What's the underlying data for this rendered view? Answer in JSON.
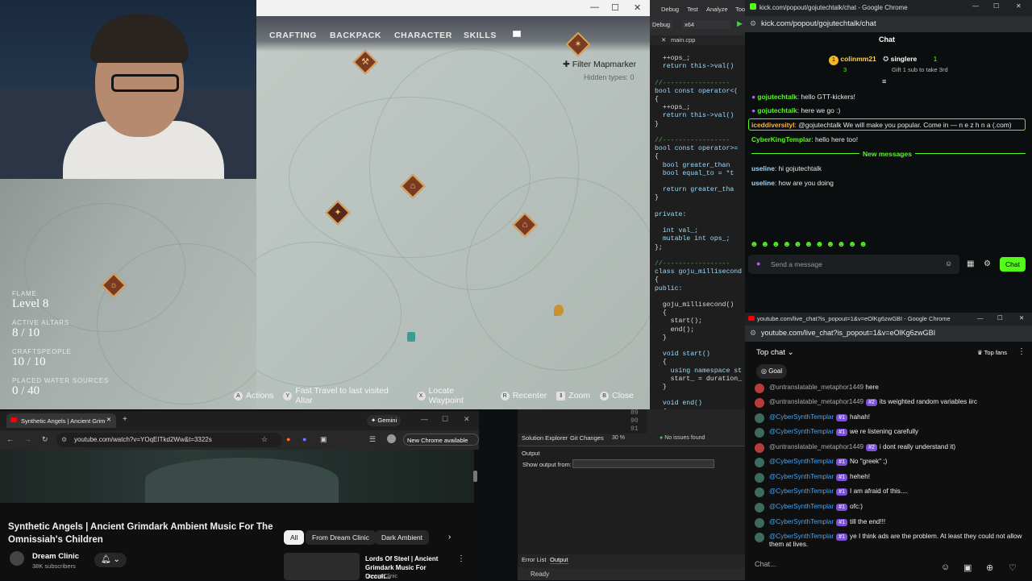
{
  "webcam": {
    "label": "webcam"
  },
  "game": {
    "window_buttons": [
      "—",
      "☐",
      "✕"
    ],
    "menu": [
      "CRAFTING",
      "BACKPACK",
      "CHARACTER",
      "SKILLS"
    ],
    "filter": {
      "label": "Filter Mapmarker",
      "hidden": "Hidden types: 0"
    },
    "stats": [
      {
        "key": "FLAME",
        "value": "Level 8"
      },
      {
        "key": "ACTIVE ALTARS",
        "value": "8 / 10"
      },
      {
        "key": "CRAFTSPEOPLE",
        "value": "10 / 10"
      },
      {
        "key": "PLACED WATER SOURCES",
        "value": "0 / 40"
      }
    ],
    "prompts": [
      "Actions",
      "Fast Travel to last visited Altar",
      "Locate Waypoint",
      "Recenter",
      "Zoom",
      "Close"
    ],
    "marker_icons": [
      "⚒",
      "⌂",
      "✦",
      "⌂",
      "☼",
      "✶",
      "⛁"
    ]
  },
  "vs": {
    "menu": [
      "Debug",
      "Test",
      "Analyze",
      "Too"
    ],
    "config": "Debug",
    "platform": "x64",
    "file_tab": "main.cpp",
    "code_lines": [
      "  ++ops_;",
      "  return this->val()",
      "",
      "//-----------------",
      "bool const operator<(",
      "{",
      "  ++ops_;",
      "  return this->val()",
      "}",
      "",
      "//-----------------",
      "bool const operator>=",
      "{",
      "  bool greater_than",
      "  bool equal_to = *t",
      "",
      "  return greater_tha",
      "}",
      "",
      "private:",
      "",
      "  int val_;",
      "  mutable int ops_;",
      "};",
      "",
      "//-----------------",
      "class goju_millisecond",
      "{",
      "public:",
      "",
      "  goju_millisecond()",
      "  {",
      "    start();",
      "    end();",
      "  }",
      "",
      "  void start()",
      "  {",
      "    using namespace st",
      "    start_ = duration_",
      "  }",
      "",
      "  void end()",
      "  {",
      "    using namespace st"
    ],
    "line_numbers": [
      "89",
      "90",
      "91"
    ],
    "zoom": "30 %",
    "issues": "No issues found",
    "panel_tabs": [
      "Solution Explorer",
      "Git Changes"
    ],
    "output_label": "Output",
    "show_output_from": "Show output from:",
    "bottom_tabs": [
      "Error List",
      "Output"
    ],
    "status": "Ready"
  },
  "kick": {
    "window_title": "kick.com/popout/gojutechtalk/chat - Google Chrome",
    "url": "kick.com/popout/gojutechtalk/chat",
    "header": "Chat",
    "pinned": {
      "user1": "colinmm21",
      "count1": "3",
      "user2": "singlere",
      "count2": "1",
      "gift": "Gift 1 sub to take 3rd"
    },
    "messages": [
      {
        "user": "gojutechtalk",
        "text": "hello GTT-kickers!",
        "color": "#53fc18"
      },
      {
        "user": "gojutechtalk",
        "text": "here we go :)",
        "color": "#53fc18"
      },
      {
        "user": "iceddiversityl",
        "text": "@gojutechtalk We will make you popular. Come in — n e z h n a (.com)",
        "color": "#ffb347"
      },
      {
        "user": "CyberKingTemplar",
        "text": "hello here too!",
        "color": "#53fc18"
      }
    ],
    "new_messages": "New messages",
    "messages2": [
      {
        "user": "useline",
        "text": "hi gojutechtalk",
        "color": "#9ad9ff"
      },
      {
        "user": "useline",
        "text": "how are you doing",
        "color": "#9ad9ff"
      }
    ],
    "input_placeholder": "Send a message",
    "chat_button": "Chat"
  },
  "ytchat": {
    "window_title": "youtube.com/live_chat?is_popout=1&v=eOlKg6zwGBI - Google Chrome",
    "url": "youtube.com/live_chat?is_popout=1&v=eOlKg6zwGBI",
    "top_chat": "Top chat",
    "top_fans": "Top fans",
    "goal": "Goal",
    "messages": [
      {
        "user": "@untranslatable_metaphor1449",
        "badge": "",
        "text": "here",
        "muted": true
      },
      {
        "user": "@untranslatable_metaphor1449",
        "badge": "#2",
        "text": "its weighted random variables iirc",
        "muted": true
      },
      {
        "user": "@CyberSynthTemplar",
        "badge": "#1",
        "text": "hahah!",
        "muted": false
      },
      {
        "user": "@CyberSynthTemplar",
        "badge": "#1",
        "text": "we re listening carefully",
        "muted": false
      },
      {
        "user": "@untranslatable_metaphor1449",
        "badge": "#2",
        "text": "i dont really understand it)",
        "muted": true
      },
      {
        "user": "@CyberSynthTemplar",
        "badge": "#1",
        "text": "No \"greek\" ;)",
        "muted": false
      },
      {
        "user": "@CyberSynthTemplar",
        "badge": "#1",
        "text": "heheh!",
        "muted": false
      },
      {
        "user": "@CyberSynthTemplar",
        "badge": "#1",
        "text": "I am afraid of this....",
        "muted": false
      },
      {
        "user": "@CyberSynthTemplar",
        "badge": "#1",
        "text": "ofc:)",
        "muted": false
      },
      {
        "user": "@CyberSynthTemplar",
        "badge": "#1",
        "text": "till the end!!!",
        "muted": false
      },
      {
        "user": "@CyberSynthTemplar",
        "badge": "#1",
        "text": "ye I think ads are the problem. At least they could not allow them at lives.",
        "muted": false
      }
    ],
    "input_placeholder": "Chat..."
  },
  "youtube": {
    "tab_title": "Synthetic Angels | Ancient Grim",
    "gemini": "Gemini",
    "url": "youtube.com/watch?v=YOqEITkd2Ww&t=3322s",
    "new_chrome": "New Chrome available",
    "title": "Synthetic Angels | Ancient Grimdark Ambient Music For The Omnissiah's Children",
    "channel": "Dream Clinic",
    "subscribers": "38K subscribers",
    "chips": [
      "All",
      "From Dream Clinic",
      "Dark Ambient"
    ],
    "rec_title": "Lords Of Steel | Ancient Grimdark Music For Occult...",
    "rec_channel": "Dream Clinic"
  }
}
